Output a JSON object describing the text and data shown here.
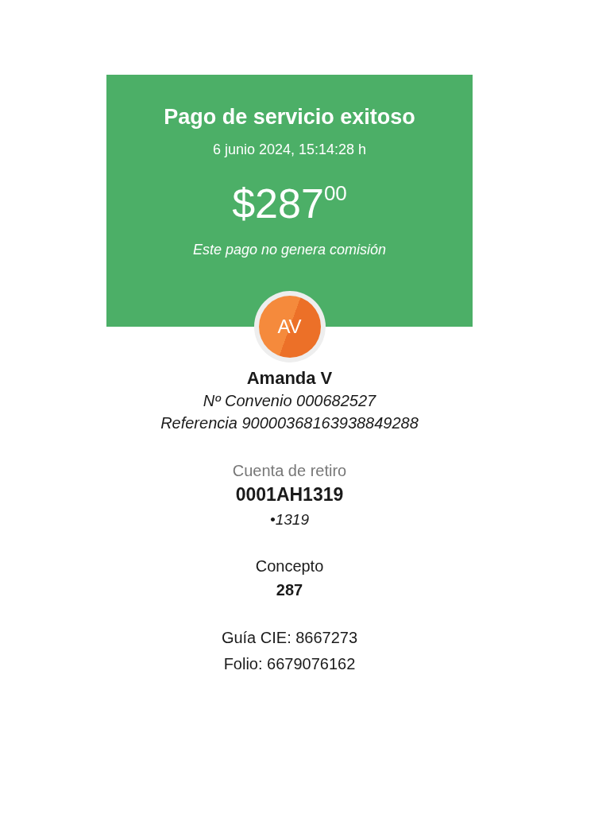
{
  "header": {
    "title": "Pago de servicio exitoso",
    "datetime": "6 junio 2024, 15:14:28 h",
    "amount": "$287$^{00}$",
    "note": "Este pago no genera comisión"
  },
  "payee": {
    "initials": "AV",
    "name": "Amanda V",
    "lines": [
      "Nº Convenio 000682527",
      "Referencia 90000368163938849288"
    ]
  },
  "account": {
    "label": "Cuenta de retiro",
    "value": "0001AH1319",
    "detail": "•1319"
  },
  "concept": {
    "label": "Concepto",
    "value": "287"
  },
  "footer_lines": [
    "Guía CIE: 8667273",
    "Folio: 6679076162"
  ]
}
